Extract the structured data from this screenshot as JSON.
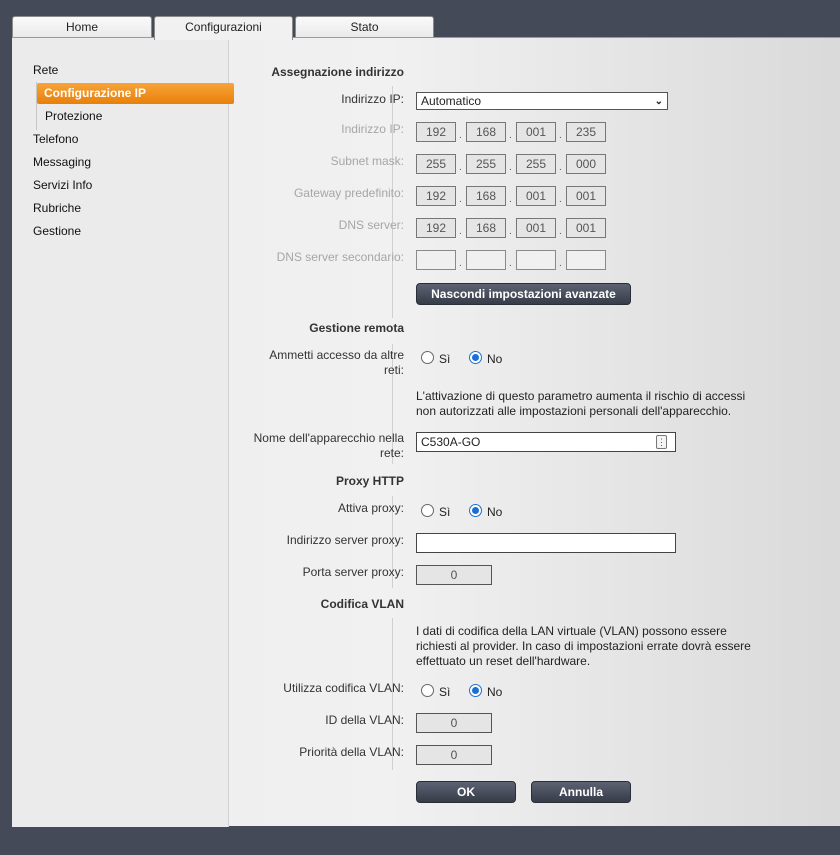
{
  "tabs": [
    {
      "label": "Home"
    },
    {
      "label": "Configurazioni"
    },
    {
      "label": "Stato"
    }
  ],
  "sidebar": {
    "items": [
      {
        "label": "Rete"
      },
      {
        "label": "Configurazione IP"
      },
      {
        "label": "Protezione"
      },
      {
        "label": "Telefono"
      },
      {
        "label": "Messaging"
      },
      {
        "label": "Servizi Info"
      },
      {
        "label": "Rubriche"
      },
      {
        "label": "Gestione"
      }
    ]
  },
  "address": {
    "title": "Assegnazione indirizzo",
    "mode_label": "Indirizzo IP:",
    "mode_value": "Automatico",
    "ip_label": "Indirizzo IP:",
    "ip": [
      "192",
      "168",
      "001",
      "235"
    ],
    "subnet_label": "Subnet mask:",
    "subnet": [
      "255",
      "255",
      "255",
      "000"
    ],
    "gateway_label": "Gateway predefinito:",
    "gateway": [
      "192",
      "168",
      "001",
      "001"
    ],
    "dns_label": "DNS server:",
    "dns": [
      "192",
      "168",
      "001",
      "001"
    ],
    "dns2_label": "DNS server secondario:",
    "dns2": [
      "",
      "",
      "",
      ""
    ],
    "advanced_button": "Nascondi impostazioni avanzate"
  },
  "remote": {
    "title": "Gestione remota",
    "access_label_1": "Ammetti accesso da altre",
    "access_label_2": "reti:",
    "yes": "Sì",
    "no": "No",
    "selected": "no",
    "warning_1": "L'attivazione di questo parametro aumenta il rischio di accessi",
    "warning_2": "non autorizzati alle impostazioni personali dell'apparecchio.",
    "device_label_1": "Nome dell'apparecchio nella",
    "device_label_2": "rete:",
    "device_name": "C530A-GO"
  },
  "proxy": {
    "title": "Proxy HTTP",
    "enable_label": "Attiva proxy:",
    "yes": "Sì",
    "no": "No",
    "selected": "no",
    "address_label": "Indirizzo server proxy:",
    "address_value": "",
    "port_label": "Porta server proxy:",
    "port_value": "0"
  },
  "vlan": {
    "title": "Codifica VLAN",
    "info_1": "I dati di codifica della LAN virtuale (VLAN) possono essere",
    "info_2": "richiesti al provider. In caso di impostazioni errate dovrà essere",
    "info_3": "effettuato un reset dell'hardware.",
    "use_label": "Utilizza codifica VLAN:",
    "yes": "Sì",
    "no": "No",
    "selected": "no",
    "id_label": "ID della VLAN:",
    "id_value": "0",
    "priority_label": "Priorità della VLAN:",
    "priority_value": "0"
  },
  "actions": {
    "ok": "OK",
    "cancel": "Annulla"
  },
  "colors": {
    "accent": "#e8800a",
    "button": "#454a58",
    "radio": "#1a6fd6"
  }
}
